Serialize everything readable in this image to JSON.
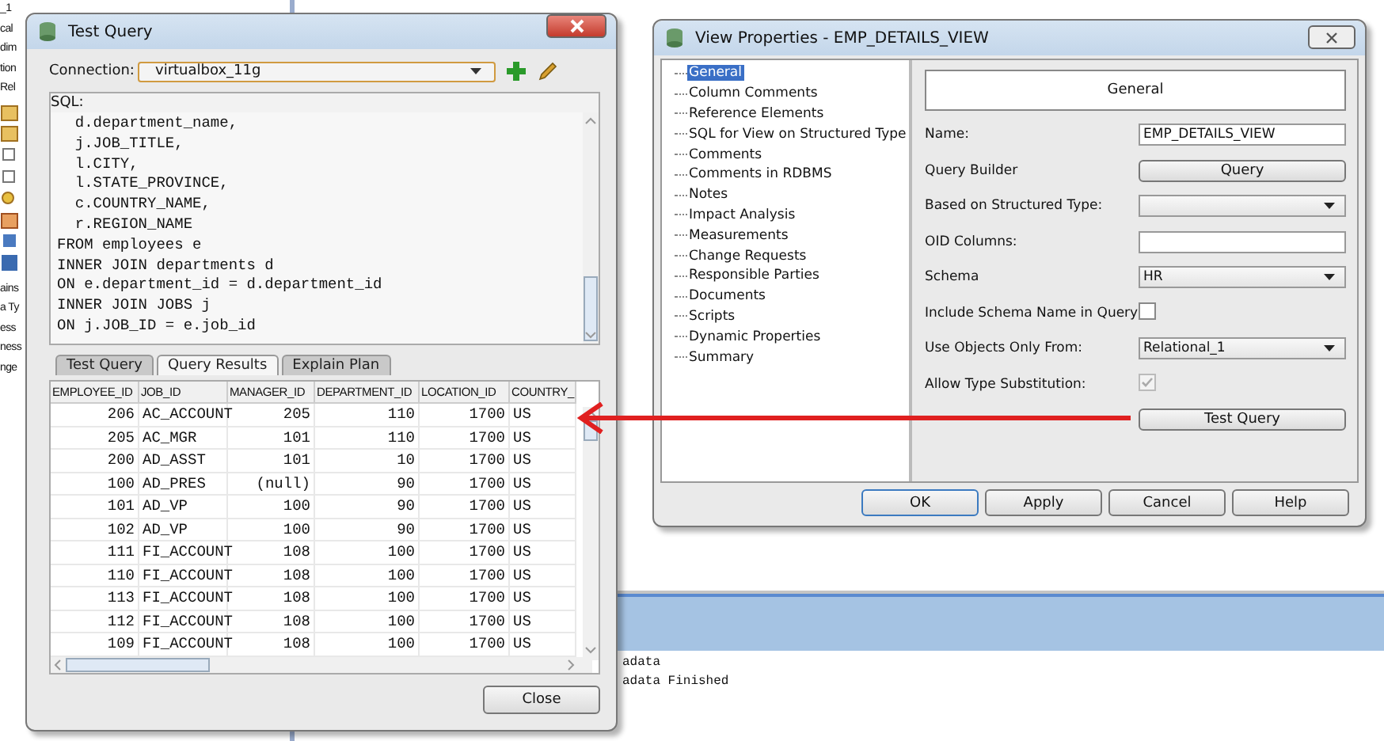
{
  "background": {
    "sidebar_fragments": [
      "_1",
      "cal",
      "dim",
      "tion",
      "Rel",
      "ains",
      "a Ty",
      "ess",
      "ness",
      "nge"
    ],
    "log_lines": [
      "adata",
      "adata Finished"
    ]
  },
  "test_query_dialog": {
    "title": "Test Query",
    "connection_label": "Connection:",
    "connection": "virtualbox_11g",
    "sql_label": "SQL:",
    "sql_lines": [
      "  d.department_name,",
      "  j.JOB_TITLE,",
      "  l.CITY,",
      "  l.STATE_PROVINCE,",
      "  c.COUNTRY_NAME,",
      "  r.REGION_NAME",
      "FROM employees e",
      "INNER JOIN departments d",
      "ON e.department_id = d.department_id",
      "INNER JOIN JOBS j",
      "ON j.JOB_ID = e.job_id"
    ],
    "tabs": [
      {
        "label": "Test Query",
        "selected": false
      },
      {
        "label": "Query Results",
        "selected": true
      },
      {
        "label": "Explain Plan",
        "selected": false
      }
    ],
    "columns": [
      "EMPLOYEE_ID",
      "JOB_ID",
      "MANAGER_ID",
      "DEPARTMENT_ID",
      "LOCATION_ID",
      "COUNTRY_"
    ],
    "rows": [
      [
        "206",
        "AC_ACCOUNT",
        "205",
        "110",
        "1700",
        "US"
      ],
      [
        "205",
        "AC_MGR",
        "101",
        "110",
        "1700",
        "US"
      ],
      [
        "200",
        "AD_ASST",
        "101",
        "10",
        "1700",
        "US"
      ],
      [
        "100",
        "AD_PRES",
        "(null)",
        "90",
        "1700",
        "US"
      ],
      [
        "101",
        "AD_VP",
        "100",
        "90",
        "1700",
        "US"
      ],
      [
        "102",
        "AD_VP",
        "100",
        "90",
        "1700",
        "US"
      ],
      [
        "111",
        "FI_ACCOUNT",
        "108",
        "100",
        "1700",
        "US"
      ],
      [
        "110",
        "FI_ACCOUNT",
        "108",
        "100",
        "1700",
        "US"
      ],
      [
        "113",
        "FI_ACCOUNT",
        "108",
        "100",
        "1700",
        "US"
      ],
      [
        "112",
        "FI_ACCOUNT",
        "108",
        "100",
        "1700",
        "US"
      ],
      [
        "109",
        "FI_ACCOUNT",
        "108",
        "100",
        "1700",
        "US"
      ]
    ],
    "close_button": "Close"
  },
  "view_properties_dialog": {
    "title": "View Properties - EMP_DETAILS_VIEW",
    "nav_items": [
      {
        "label": "General",
        "selected": true
      },
      {
        "label": "Column Comments",
        "selected": false
      },
      {
        "label": "Reference Elements",
        "selected": false
      },
      {
        "label": "SQL for View on Structured Type",
        "selected": false
      },
      {
        "label": "Comments",
        "selected": false
      },
      {
        "label": "Comments in RDBMS",
        "selected": false
      },
      {
        "label": "Notes",
        "selected": false
      },
      {
        "label": "Impact Analysis",
        "selected": false
      },
      {
        "label": "Measurements",
        "selected": false
      },
      {
        "label": "Change Requests",
        "selected": false
      },
      {
        "label": "Responsible Parties",
        "selected": false
      },
      {
        "label": "Documents",
        "selected": false
      },
      {
        "label": "Scripts",
        "selected": false
      },
      {
        "label": "Dynamic Properties",
        "selected": false
      },
      {
        "label": "Summary",
        "selected": false
      }
    ],
    "panel_header": "General",
    "fields": [
      {
        "label": "Name:",
        "kind": "text",
        "value": "EMP_DETAILS_VIEW"
      },
      {
        "label": "Query Builder",
        "kind": "button",
        "value": "Query"
      },
      {
        "label": "Based on Structured Type:",
        "kind": "select"
      },
      {
        "label": "OID Columns:",
        "kind": "text"
      },
      {
        "label": "Schema",
        "kind": "select",
        "value": "HR"
      },
      {
        "label": "Include Schema Name in Query",
        "kind": "checkbox",
        "checked": false,
        "disabled": false
      },
      {
        "label": "Use Objects Only From:",
        "kind": "select",
        "value": "Relational_1"
      },
      {
        "label": "Allow Type Substitution:",
        "kind": "checkbox",
        "checked": true,
        "disabled": true
      }
    ],
    "test_query_button": "Test Query",
    "buttons": [
      {
        "label": "OK",
        "default": true
      },
      {
        "label": "Apply",
        "default": false
      },
      {
        "label": "Cancel",
        "default": false
      },
      {
        "label": "Help",
        "default": false
      }
    ]
  }
}
